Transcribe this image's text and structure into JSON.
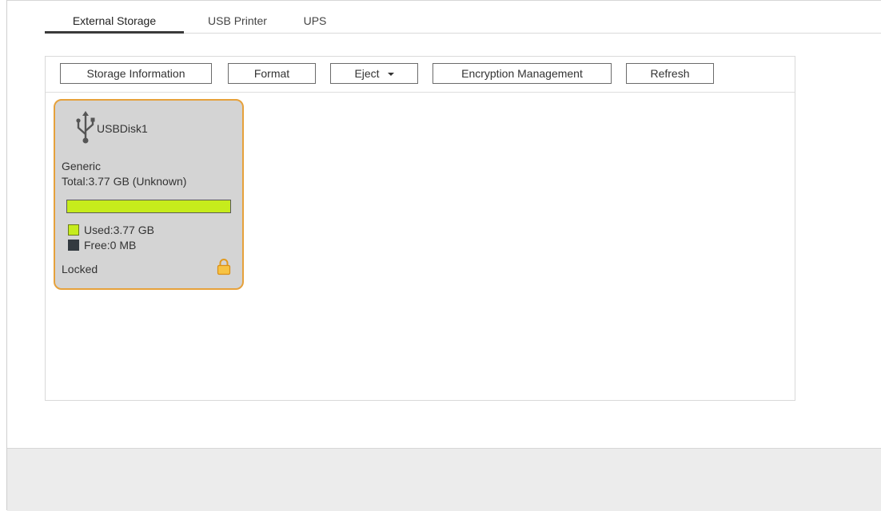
{
  "tabs": [
    {
      "label": "External Storage",
      "active": true
    },
    {
      "label": "USB Printer",
      "active": false
    },
    {
      "label": "UPS",
      "active": false
    }
  ],
  "toolbar": {
    "storage_info_label": "Storage Information",
    "format_label": "Format",
    "eject_label": "Eject",
    "encryption_label": "Encryption Management",
    "refresh_label": "Refresh"
  },
  "disk": {
    "icon": "usb-icon",
    "name": "USBDisk1",
    "vendor": "Generic",
    "total": "Total:3.77 GB (Unknown)",
    "used_fraction": 1.0,
    "used": "Used:3.77 GB",
    "free": "Free:0 MB",
    "status": "Locked",
    "status_icon": "lock-icon"
  },
  "colors": {
    "card_border": "#e6a13b",
    "used": "#c6ec1c",
    "free": "#333a40",
    "lock": "#f2b632"
  }
}
